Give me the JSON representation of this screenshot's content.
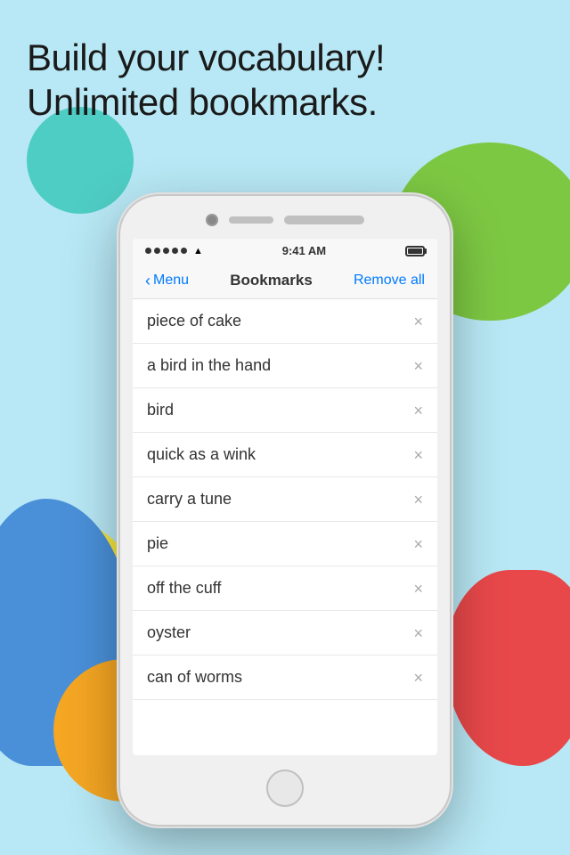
{
  "background": {
    "color": "#b8e8f5"
  },
  "header": {
    "line1": "Build your vocabulary!",
    "line2": "Unlimited bookmarks."
  },
  "status_bar": {
    "signal": "•••••",
    "wifi": "WiFi",
    "time": "9:41 AM",
    "battery_label": "battery"
  },
  "nav": {
    "back_label": "Menu",
    "title": "Bookmarks",
    "action_label": "Remove all"
  },
  "bookmarks": [
    {
      "id": 1,
      "text": "piece of cake"
    },
    {
      "id": 2,
      "text": "a bird in the hand"
    },
    {
      "id": 3,
      "text": "bird"
    },
    {
      "id": 4,
      "text": "quick as a wink"
    },
    {
      "id": 5,
      "text": "carry a tune"
    },
    {
      "id": 6,
      "text": "pie"
    },
    {
      "id": 7,
      "text": "off the cuff"
    },
    {
      "id": 8,
      "text": "oyster"
    },
    {
      "id": 9,
      "text": "can of worms"
    }
  ]
}
